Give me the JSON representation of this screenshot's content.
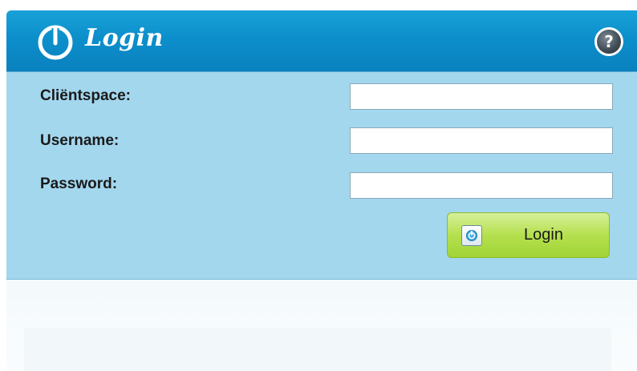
{
  "header": {
    "title": "Login",
    "logo_icon": "power-logo-icon",
    "help_symbol": "?",
    "help_icon": "help-icon"
  },
  "form": {
    "clientspace_label": "Cliëntspace:",
    "clientspace_value": "",
    "username_label": "Username:",
    "username_value": "",
    "password_label": "Password:",
    "password_value": ""
  },
  "login_button": {
    "label": "Login",
    "icon": "login-logo-icon"
  },
  "colors": {
    "header_blue": "#0c8fcb",
    "panel_blue": "#a3d7ee",
    "button_green": "#b5e04e"
  }
}
